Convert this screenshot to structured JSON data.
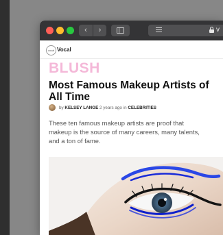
{
  "browser": {
    "nav_back": "‹",
    "nav_forward": "›",
    "url_visible_fragment": "v"
  },
  "site": {
    "logo_text": "vocal",
    "name": "Vocal"
  },
  "article": {
    "community": "BLUSH",
    "title": "Most Famous Makeup Artists of All Time",
    "byline_prefix": "by",
    "author": "KELSEY LANGE",
    "time": "2 years ago in",
    "category": "CELEBRITIES",
    "excerpt": "These ten famous makeup artists are proof that makeup is the source of many careers, many talents, and a ton of fame."
  },
  "colors": {
    "community_pink": "#f4b8d8",
    "eyeliner_blue": "#1a2bd8",
    "titlebar": "#343436"
  },
  "icons": [
    "close-dot",
    "minimize-dot",
    "zoom-dot",
    "back-chevron",
    "forward-chevron",
    "sidebar-icon",
    "reader-icon",
    "lock-icon",
    "author-avatar"
  ]
}
